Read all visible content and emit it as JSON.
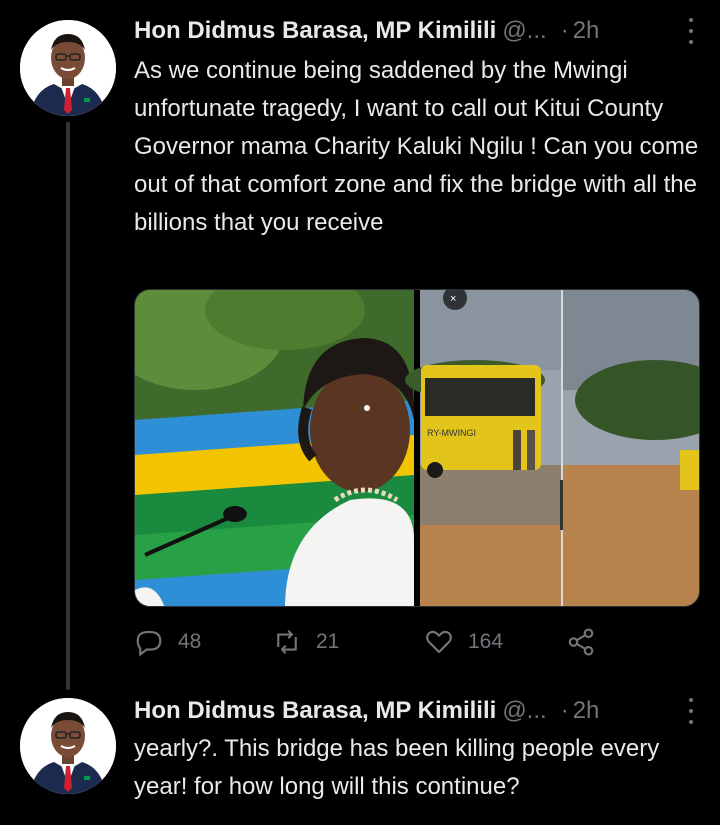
{
  "tweets": [
    {
      "author": "Hon Didmus Barasa, MP Kimilili",
      "handle": "@...",
      "separator": "·",
      "time": "2h",
      "text": "As we continue being saddened by the Mwingi unfortunate tragedy, I want to call out  Kitui County Governor mama Charity Kaluki Ngilu ! Can you come out of that comfort zone and fix the bridge with all the billions that you receive",
      "replies": "48",
      "retweets": "21",
      "likes": "164",
      "bus_sign": "RY-MWINGI"
    },
    {
      "author": "Hon Didmus Barasa, MP Kimilili",
      "handle": "@...",
      "separator": "·",
      "time": "2h",
      "text": "yearly?. This bridge has been killing people every year! for how long will this continue?"
    }
  ],
  "icons": {
    "reply": "speech-bubble-icon",
    "retweet": "retweet-icon",
    "like": "heart-icon",
    "share": "share-icon",
    "more": "vertical-ellipsis-icon"
  },
  "colors": {
    "background": "#000000",
    "text": "#e7e9ea",
    "secondary": "#71767b",
    "thread_line": "#333639"
  }
}
